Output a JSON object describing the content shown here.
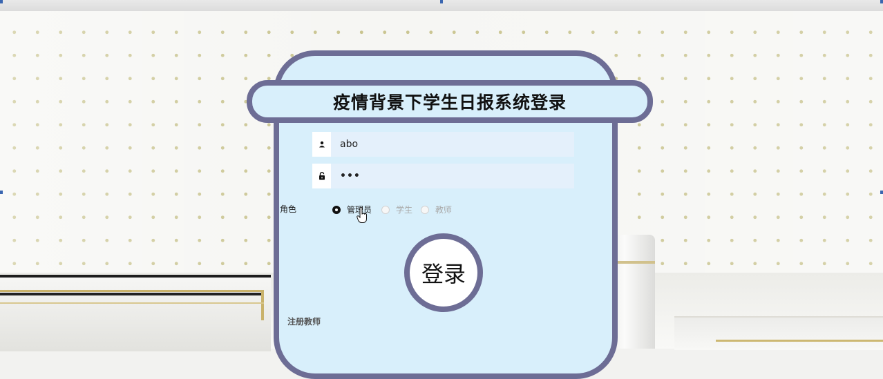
{
  "page": {
    "title": "疫情背景下学生日报系统登录"
  },
  "form": {
    "username_value": "abo",
    "password_value": "•••",
    "role_label": "角色",
    "roles": [
      {
        "label": "管理员",
        "checked": true
      },
      {
        "label": "学生",
        "checked": false
      },
      {
        "label": "教师",
        "checked": false
      }
    ],
    "login_label": "登录",
    "register_label": "注册教师"
  },
  "icons": {
    "user": "user-icon",
    "lock": "lock-icon",
    "cursor": "hand-pointer-icon"
  },
  "colors": {
    "card_bg": "#d8effb",
    "card_border": "#6d6d95",
    "input_bg": "#e4f0fb"
  }
}
